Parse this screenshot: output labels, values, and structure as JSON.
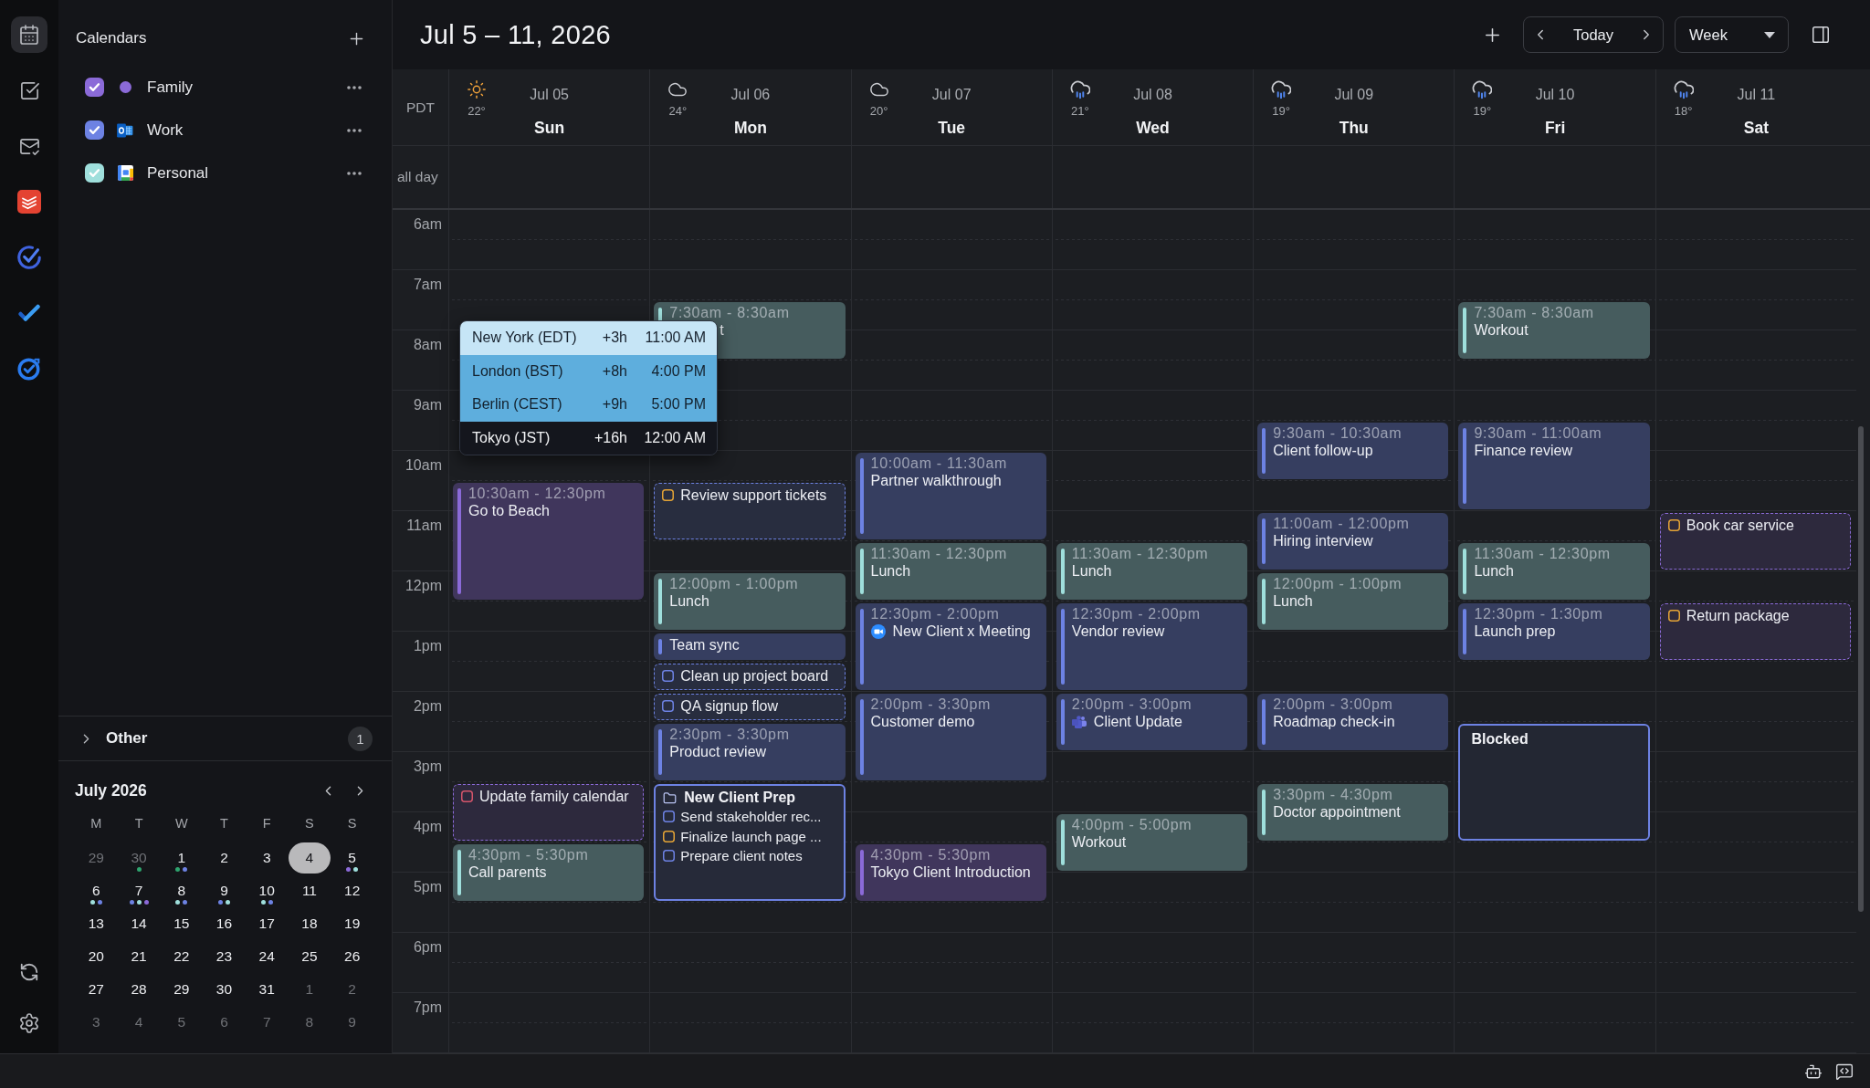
{
  "rail": {
    "items": [
      {
        "selected": true
      },
      {
        "selected": false
      },
      {
        "selected": false
      }
    ]
  },
  "sidebar": {
    "title": "Calendars",
    "calendars": [
      {
        "name": "Family",
        "checked": true,
        "color": "#8b6ad8",
        "kind": "local"
      },
      {
        "name": "Work",
        "checked": true,
        "color": "#6d82e3",
        "kind": "outlook"
      },
      {
        "name": "Personal",
        "checked": true,
        "color": "#9fdfdc",
        "kind": "google"
      }
    ],
    "other": {
      "label": "Other",
      "count": "1",
      "expanded": false
    },
    "mini_calendar": {
      "title": "July 2026",
      "weekdays": [
        "M",
        "T",
        "W",
        "T",
        "F",
        "S",
        "S"
      ],
      "days": [
        {
          "label": "29",
          "muted": true,
          "selected": false
        },
        {
          "label": "30",
          "muted": true,
          "selected": false,
          "dots": [
            {
              "color": "#2ea46e"
            }
          ]
        },
        {
          "label": "1",
          "muted": false,
          "selected": false,
          "dots": [
            {
              "color": "#2ea46e"
            },
            {
              "color": "#6d82e3"
            }
          ]
        },
        {
          "label": "2",
          "muted": false,
          "selected": false
        },
        {
          "label": "3",
          "muted": false,
          "selected": false
        },
        {
          "label": "4",
          "muted": false,
          "selected": true
        },
        {
          "label": "5",
          "muted": false,
          "selected": false,
          "dots": [
            {
              "color": "#8b6ad8"
            },
            {
              "color": "#9fdfdc"
            }
          ]
        },
        {
          "label": "6",
          "muted": false,
          "selected": false,
          "dots": [
            {
              "color": "#9fdfdc"
            },
            {
              "color": "#6d82e3"
            }
          ]
        },
        {
          "label": "7",
          "muted": false,
          "selected": false,
          "dots": [
            {
              "color": "#6d82e3"
            },
            {
              "color": "#9fdfdc"
            },
            {
              "color": "#8b6ad8"
            }
          ]
        },
        {
          "label": "8",
          "muted": false,
          "selected": false,
          "dots": [
            {
              "color": "#9fdfdc"
            },
            {
              "color": "#6d82e3"
            }
          ]
        },
        {
          "label": "9",
          "muted": false,
          "selected": false,
          "dots": [
            {
              "color": "#6d82e3"
            },
            {
              "color": "#9fdfdc"
            }
          ]
        },
        {
          "label": "10",
          "muted": false,
          "selected": false,
          "dots": [
            {
              "color": "#9fdfdc"
            },
            {
              "color": "#6d82e3"
            }
          ]
        },
        {
          "label": "11",
          "muted": false,
          "selected": false
        },
        {
          "label": "12",
          "muted": false,
          "selected": false
        },
        {
          "label": "13",
          "muted": false,
          "selected": false
        },
        {
          "label": "14",
          "muted": false,
          "selected": false
        },
        {
          "label": "15",
          "muted": false,
          "selected": false
        },
        {
          "label": "16",
          "muted": false,
          "selected": false
        },
        {
          "label": "17",
          "muted": false,
          "selected": false
        },
        {
          "label": "18",
          "muted": false,
          "selected": false
        },
        {
          "label": "19",
          "muted": false,
          "selected": false
        },
        {
          "label": "20",
          "muted": false,
          "selected": false
        },
        {
          "label": "21",
          "muted": false,
          "selected": false
        },
        {
          "label": "22",
          "muted": false,
          "selected": false
        },
        {
          "label": "23",
          "muted": false,
          "selected": false
        },
        {
          "label": "24",
          "muted": false,
          "selected": false
        },
        {
          "label": "25",
          "muted": false,
          "selected": false
        },
        {
          "label": "26",
          "muted": false,
          "selected": false
        },
        {
          "label": "27",
          "muted": false,
          "selected": false
        },
        {
          "label": "28",
          "muted": false,
          "selected": false
        },
        {
          "label": "29",
          "muted": false,
          "selected": false
        },
        {
          "label": "30",
          "muted": false,
          "selected": false
        },
        {
          "label": "31",
          "muted": false,
          "selected": false
        },
        {
          "label": "1",
          "muted": true,
          "selected": false
        },
        {
          "label": "2",
          "muted": true,
          "selected": false
        },
        {
          "label": "3",
          "muted": true,
          "selected": false
        },
        {
          "label": "4",
          "muted": true,
          "selected": false
        },
        {
          "label": "5",
          "muted": true,
          "selected": false
        },
        {
          "label": "6",
          "muted": true,
          "selected": false
        },
        {
          "label": "7",
          "muted": true,
          "selected": false
        },
        {
          "label": "8",
          "muted": true,
          "selected": false
        },
        {
          "label": "9",
          "muted": true,
          "selected": false
        }
      ]
    }
  },
  "header": {
    "title": "Jul 5 – 11, 2026",
    "today": "Today",
    "view": "Week"
  },
  "timezone": "PDT",
  "all_day_label": "all day",
  "hours": [
    "6am",
    "7am",
    "8am",
    "9am",
    "10am",
    "11am",
    "12pm",
    "1pm",
    "2pm",
    "3pm",
    "4pm",
    "5pm",
    "6pm",
    "7pm"
  ],
  "days": [
    {
      "weather": {
        "kind": "sun"
      },
      "temp": "22°",
      "date": "Jul 05",
      "name": "Sun",
      "slots": [
        {
          "kind": "free"
        },
        {
          "kind": "free"
        },
        {
          "kind": "free"
        },
        {
          "kind": "free"
        },
        {
          "kind": "free"
        },
        {
          "kind": "free"
        },
        {
          "kind": "free"
        },
        {
          "kind": "free"
        },
        {
          "kind": "free"
        },
        {
          "kind": "event",
          "time": "10:30am - 12:30pm",
          "title": "Go to Beach",
          "color": "#8b6ad8"
        },
        {
          "kind": "cont"
        },
        {
          "kind": "cont"
        },
        {
          "kind": "cont"
        },
        {
          "kind": "free"
        },
        {
          "kind": "free"
        },
        {
          "kind": "free"
        },
        {
          "kind": "free"
        },
        {
          "kind": "free"
        },
        {
          "kind": "free"
        },
        {
          "kind": "task",
          "title": "Update family calendar",
          "color": "#8b6ad8",
          "checkbox": {
            "color": "#d4556b",
            "checked": false
          }
        },
        {
          "kind": "cont"
        },
        {
          "kind": "event",
          "time": "4:30pm - 5:30pm",
          "title": "Call parents",
          "color": "#9fdfdc"
        },
        {
          "kind": "cont"
        }
      ]
    },
    {
      "weather": {
        "kind": "cloud"
      },
      "temp": "24°",
      "date": "Jul 06",
      "name": "Mon",
      "slots": [
        {
          "kind": "free"
        },
        {
          "kind": "free"
        },
        {
          "kind": "free"
        },
        {
          "kind": "event",
          "time": "7:30am - 8:30am",
          "title": "t",
          "covered": true,
          "color": "#9fdfdc"
        },
        {
          "kind": "cont"
        },
        {
          "kind": "free"
        },
        {
          "kind": "free"
        },
        {
          "kind": "free"
        },
        {
          "kind": "free"
        },
        {
          "kind": "task",
          "title": "Review support tickets",
          "color": "#6d82e3",
          "checkbox": {
            "color": "#e3a336",
            "checked": false
          }
        },
        {
          "kind": "cont"
        },
        {
          "kind": "free"
        },
        {
          "kind": "event",
          "time": "12:00pm - 1:00pm",
          "title": "Lunch",
          "color": "#9fdfdc"
        },
        {
          "kind": "cont"
        },
        {
          "kind": "event",
          "title": "Team sync",
          "color": "#6d82e3"
        },
        {
          "kind": "task",
          "title": "Clean up project board",
          "color": "#6d82e3",
          "checkbox": {
            "color": "#6d82e3",
            "checked": false
          }
        },
        {
          "kind": "task",
          "title": "QA signup flow",
          "color": "#6d82e3",
          "checkbox": {
            "color": "#6d82e3",
            "checked": false
          }
        },
        {
          "kind": "event",
          "time": "2:30pm - 3:30pm",
          "title": "Product review",
          "color": "#6d82e3"
        },
        {
          "kind": "cont"
        },
        {
          "kind": "project",
          "title": "New Client Prep",
          "color": "#6d82e3",
          "tasks": [
            {
              "title": "Send stakeholder rec...",
              "checkbox": {
                "color": "#6d82e3",
                "checked": false
              }
            },
            {
              "title": "Finalize launch page ...",
              "checkbox": {
                "color": "#e3a336",
                "checked": false
              }
            },
            {
              "title": "Prepare client notes",
              "checkbox": {
                "color": "#6d82e3",
                "checked": false
              }
            }
          ]
        },
        {
          "kind": "cont"
        },
        {
          "kind": "cont"
        },
        {
          "kind": "cont"
        }
      ]
    },
    {
      "weather": {
        "kind": "cloud"
      },
      "temp": "20°",
      "date": "Jul 07",
      "name": "Tue",
      "slots": [
        {
          "kind": "free"
        },
        {
          "kind": "free"
        },
        {
          "kind": "free"
        },
        {
          "kind": "free"
        },
        {
          "kind": "free"
        },
        {
          "kind": "free"
        },
        {
          "kind": "free"
        },
        {
          "kind": "free"
        },
        {
          "kind": "event",
          "time": "10:00am - 11:30am",
          "title": "Partner walkthrough",
          "color": "#6d82e3"
        },
        {
          "kind": "cont"
        },
        {
          "kind": "cont"
        },
        {
          "kind": "event",
          "time": "11:30am - 12:30pm",
          "title": "Lunch",
          "color": "#9fdfdc"
        },
        {
          "kind": "cont"
        },
        {
          "kind": "event",
          "time": "12:30pm - 2:00pm",
          "title": "New Client x Meeting",
          "link": {
            "kind": "video"
          },
          "color": "#6d82e3"
        },
        {
          "kind": "cont"
        },
        {
          "kind": "cont"
        },
        {
          "kind": "event",
          "time": "2:00pm - 3:30pm",
          "title": "Customer demo",
          "color": "#6d82e3"
        },
        {
          "kind": "cont"
        },
        {
          "kind": "cont"
        },
        {
          "kind": "free"
        },
        {
          "kind": "free"
        },
        {
          "kind": "event",
          "time": "4:30pm - 5:30pm",
          "title": "Tokyo Client Introduction",
          "color": "#8b6ad8"
        },
        {
          "kind": "cont"
        }
      ]
    },
    {
      "weather": {
        "kind": "rain"
      },
      "temp": "21°",
      "date": "Jul 08",
      "name": "Wed",
      "slots": [
        {
          "kind": "free"
        },
        {
          "kind": "free"
        },
        {
          "kind": "free"
        },
        {
          "kind": "free"
        },
        {
          "kind": "free"
        },
        {
          "kind": "free"
        },
        {
          "kind": "free"
        },
        {
          "kind": "free"
        },
        {
          "kind": "free"
        },
        {
          "kind": "free"
        },
        {
          "kind": "free"
        },
        {
          "kind": "event",
          "time": "11:30am - 12:30pm",
          "title": "Lunch",
          "color": "#9fdfdc"
        },
        {
          "kind": "cont"
        },
        {
          "kind": "event",
          "time": "12:30pm - 2:00pm",
          "title": "Vendor review",
          "color": "#6d82e3"
        },
        {
          "kind": "cont"
        },
        {
          "kind": "cont"
        },
        {
          "kind": "event",
          "time": "2:00pm - 3:00pm",
          "title": "Client Update",
          "link": {
            "kind": "team"
          },
          "color": "#6d82e3"
        },
        {
          "kind": "cont"
        },
        {
          "kind": "free"
        },
        {
          "kind": "free"
        },
        {
          "kind": "event",
          "time": "4:00pm - 5:00pm",
          "title": "Workout",
          "color": "#9fdfdc"
        },
        {
          "kind": "cont"
        }
      ]
    },
    {
      "weather": {
        "kind": "rain"
      },
      "temp": "19°",
      "date": "Jul 09",
      "name": "Thu",
      "slots": [
        {
          "kind": "free"
        },
        {
          "kind": "free"
        },
        {
          "kind": "free"
        },
        {
          "kind": "free"
        },
        {
          "kind": "free"
        },
        {
          "kind": "free"
        },
        {
          "kind": "free"
        },
        {
          "kind": "event",
          "time": "9:30am - 10:30am",
          "title": "Client follow-up",
          "color": "#6d82e3"
        },
        {
          "kind": "cont"
        },
        {
          "kind": "free"
        },
        {
          "kind": "event",
          "time": "11:00am - 12:00pm",
          "title": "Hiring interview",
          "color": "#6d82e3"
        },
        {
          "kind": "cont"
        },
        {
          "kind": "event",
          "time": "12:00pm - 1:00pm",
          "title": "Lunch",
          "color": "#9fdfdc"
        },
        {
          "kind": "cont"
        },
        {
          "kind": "free"
        },
        {
          "kind": "free"
        },
        {
          "kind": "event",
          "time": "2:00pm - 3:00pm",
          "title": "Roadmap check-in",
          "color": "#6d82e3"
        },
        {
          "kind": "cont"
        },
        {
          "kind": "free"
        },
        {
          "kind": "event",
          "time": "3:30pm - 4:30pm",
          "title": "Doctor appointment",
          "color": "#9fdfdc"
        },
        {
          "kind": "cont"
        }
      ]
    },
    {
      "weather": {
        "kind": "rain"
      },
      "temp": "19°",
      "date": "Jul 10",
      "name": "Fri",
      "slots": [
        {
          "kind": "free"
        },
        {
          "kind": "free"
        },
        {
          "kind": "free"
        },
        {
          "kind": "event",
          "time": "7:30am - 8:30am",
          "title": "Workout",
          "color": "#9fdfdc"
        },
        {
          "kind": "cont"
        },
        {
          "kind": "free"
        },
        {
          "kind": "free"
        },
        {
          "kind": "event",
          "time": "9:30am - 11:00am",
          "title": "Finance review",
          "color": "#6d82e3"
        },
        {
          "kind": "cont"
        },
        {
          "kind": "cont"
        },
        {
          "kind": "free"
        },
        {
          "kind": "event",
          "time": "11:30am - 12:30pm",
          "title": "Lunch",
          "color": "#9fdfdc"
        },
        {
          "kind": "cont"
        },
        {
          "kind": "event",
          "time": "12:30pm - 1:30pm",
          "title": "Launch prep",
          "color": "#6d82e3"
        },
        {
          "kind": "cont"
        },
        {
          "kind": "free"
        },
        {
          "kind": "free"
        },
        {
          "kind": "block",
          "title": "Blocked",
          "color": "#6d82e3"
        },
        {
          "kind": "cont"
        },
        {
          "kind": "cont"
        },
        {
          "kind": "cont"
        }
      ]
    },
    {
      "weather": {
        "kind": "rain"
      },
      "temp": "18°",
      "date": "Jul 11",
      "name": "Sat",
      "slots": [
        {
          "kind": "free"
        },
        {
          "kind": "free"
        },
        {
          "kind": "free"
        },
        {
          "kind": "free"
        },
        {
          "kind": "free"
        },
        {
          "kind": "free"
        },
        {
          "kind": "free"
        },
        {
          "kind": "free"
        },
        {
          "kind": "free"
        },
        {
          "kind": "free"
        },
        {
          "kind": "task",
          "title": "Book car service",
          "color": "#8b6ad8",
          "checkbox": {
            "color": "#e3a336",
            "checked": false
          }
        },
        {
          "kind": "cont"
        },
        {
          "kind": "free"
        },
        {
          "kind": "task",
          "title": "Return package",
          "color": "#8b6ad8",
          "checkbox": {
            "color": "#e3a336",
            "checked": false
          }
        },
        {
          "kind": "cont"
        }
      ]
    }
  ],
  "timezone_popup": {
    "rows": [
      {
        "city": "New York (EDT)",
        "offset": "+3h",
        "time": "11:00 AM",
        "kind": "morning"
      },
      {
        "city": "London (BST)",
        "offset": "+8h",
        "time": "4:00 PM",
        "kind": "afternoon"
      },
      {
        "city": "Berlin (CEST)",
        "offset": "+9h",
        "time": "5:00 PM",
        "kind": "afternoon"
      },
      {
        "city": "Tokyo (JST)",
        "offset": "+16h",
        "time": "12:00 AM",
        "kind": "night"
      }
    ]
  }
}
